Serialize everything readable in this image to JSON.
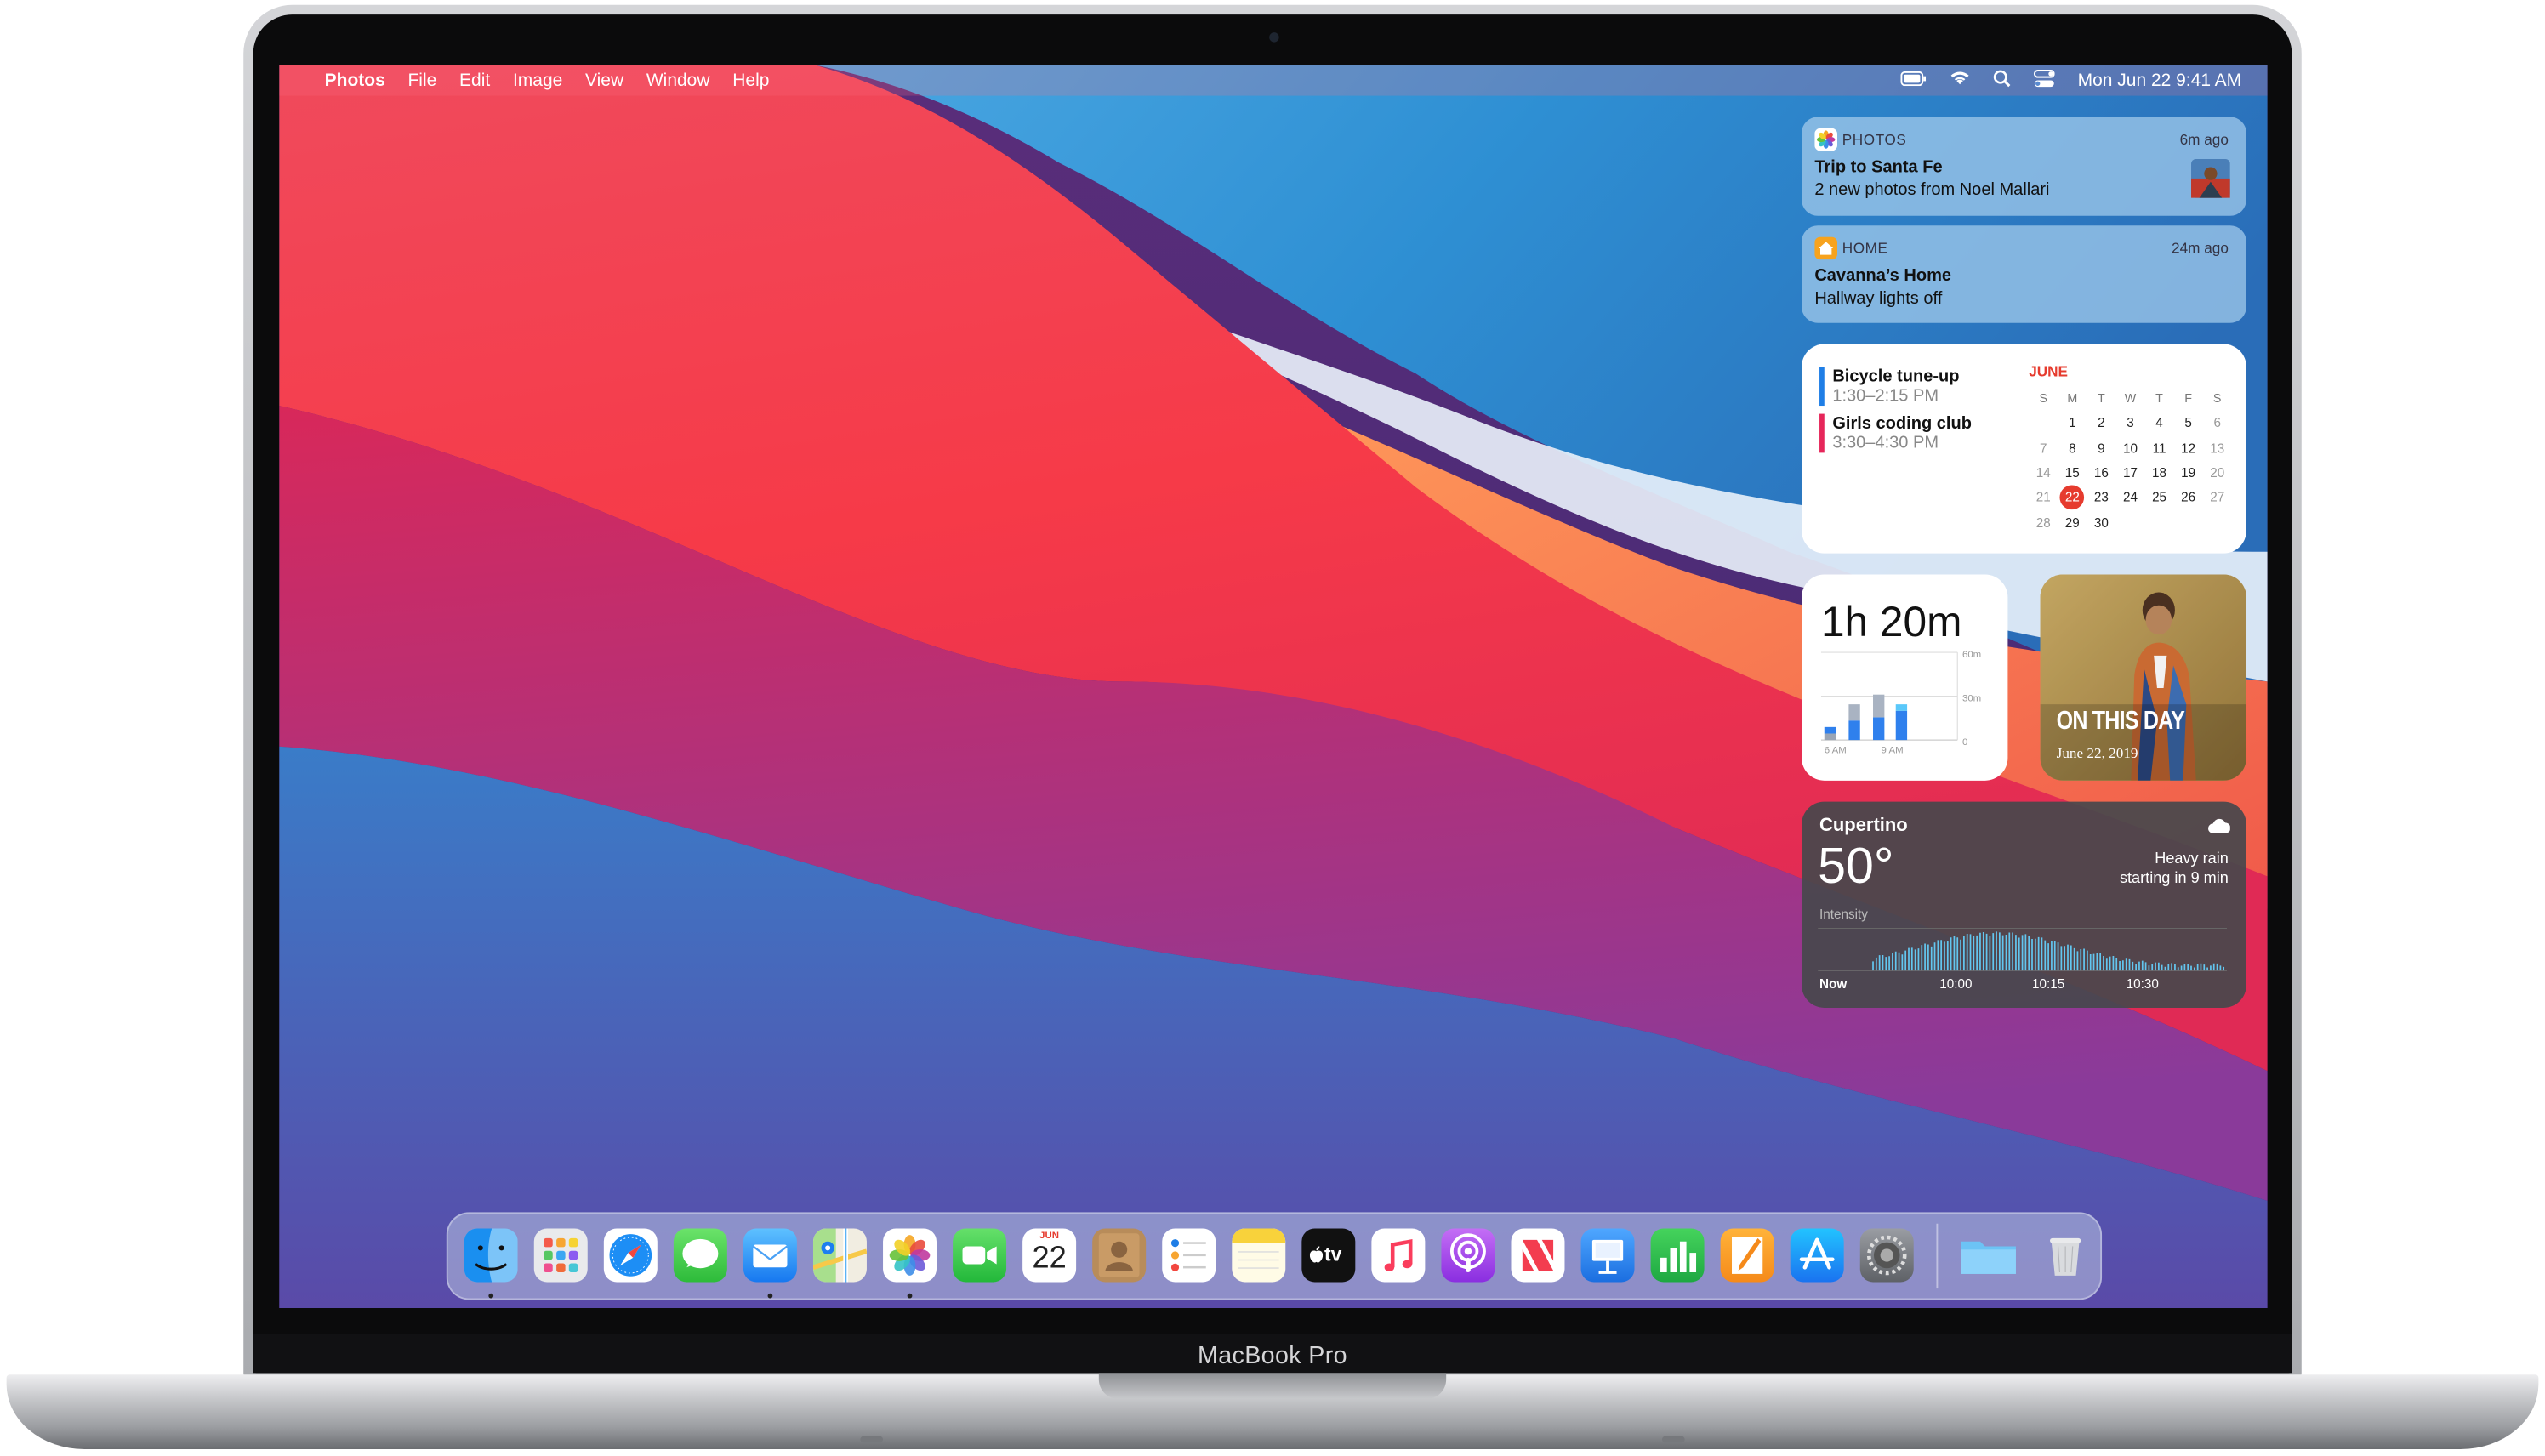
{
  "menubar": {
    "apple": "",
    "app_name": "Photos",
    "menus": [
      "File",
      "Edit",
      "Image",
      "View",
      "Window",
      "Help"
    ],
    "clock": "Mon Jun 22  9:41 AM"
  },
  "notifications": [
    {
      "app": "PHOTOS",
      "time": "6m ago",
      "title": "Trip to Santa Fe",
      "body": "2 new photos from Noel Mallari",
      "icon": "photos-icon"
    },
    {
      "app": "HOME",
      "time": "24m ago",
      "title": "Cavanna’s Home",
      "body": "Hallway lights off",
      "icon": "home-icon"
    }
  ],
  "calendar_widget": {
    "events": [
      {
        "name": "Bicycle tune-up",
        "time": "1:30–2:15 PM",
        "color": "#1f7ee6"
      },
      {
        "name": "Girls coding club",
        "time": "3:30–4:30 PM",
        "color": "#e6265a"
      }
    ],
    "month": "JUNE",
    "weekdays": [
      "S",
      "M",
      "T",
      "W",
      "T",
      "F",
      "S"
    ],
    "weeks": [
      [
        "",
        "1",
        "2",
        "3",
        "4",
        "5",
        "6"
      ],
      [
        "7",
        "8",
        "9",
        "10",
        "11",
        "12",
        "13"
      ],
      [
        "14",
        "15",
        "16",
        "17",
        "18",
        "19",
        "20"
      ],
      [
        "21",
        "22",
        "23",
        "24",
        "25",
        "26",
        "27"
      ],
      [
        "28",
        "29",
        "30",
        "",
        "",
        "",
        ""
      ]
    ],
    "today": "22"
  },
  "screen_time_widget": {
    "total": "1h 20m",
    "y_ticks": [
      "60m",
      "30m",
      "0"
    ],
    "x_labels": [
      "6 AM",
      "9 AM"
    ]
  },
  "photo_widget": {
    "title": "ON THIS DAY",
    "date": "June 22, 2019"
  },
  "weather_widget": {
    "location": "Cupertino",
    "temp": "50°",
    "condition_line1": "Heavy rain",
    "condition_line2": "starting in 9 min",
    "intensity_label": "Intensity",
    "x_labels": [
      "Now",
      "10:00",
      "10:15",
      "10:30"
    ]
  },
  "dock": {
    "apps": [
      "finder-icon",
      "launchpad-icon",
      "safari-icon",
      "messages-icon",
      "mail-icon",
      "maps-icon",
      "photos-icon",
      "facetime-icon",
      "calendar-icon",
      "contacts-icon",
      "reminders-icon",
      "notes-icon",
      "tv-icon",
      "music-icon",
      "podcasts-icon",
      "news-icon",
      "keynote-icon",
      "numbers-icon",
      "pages-icon",
      "app-store-icon",
      "system-preferences-icon",
      "downloads-folder-icon",
      "trash-icon"
    ],
    "calendar_month": "JUN",
    "calendar_day": "22",
    "tv_label": "tv"
  },
  "device_label": "MacBook Pro"
}
